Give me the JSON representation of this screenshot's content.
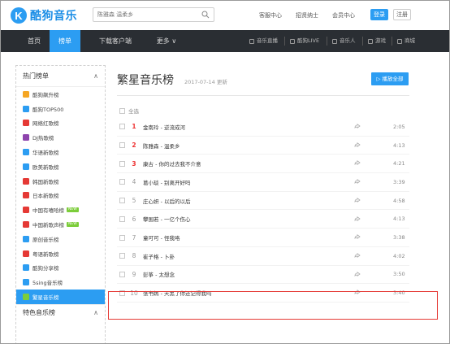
{
  "header": {
    "logo_glyph": "K",
    "logo_text": "酷狗音乐",
    "search_placeholder": "陈雅森 温柔乡",
    "links": [
      "客服中心",
      "招贤纳士",
      "会员中心"
    ],
    "login_label": "登录",
    "register_label": "注册"
  },
  "nav": {
    "items": [
      "首页",
      "榜单",
      "下载客户端",
      "更多 ∨"
    ],
    "active": "榜单",
    "right_items": [
      "音乐直播",
      "酷狗LIVE",
      "音乐人",
      "游戏",
      "商城"
    ]
  },
  "sidebar": {
    "heading": "热门榜单",
    "collapse_glyph": "∧",
    "items": [
      {
        "label": "酷狗飙升榜",
        "color": "#f5a623"
      },
      {
        "label": "酷狗TOP500",
        "color": "#2c9df2"
      },
      {
        "label": "网络红歌榜",
        "color": "#e53935"
      },
      {
        "label": "DJ热歌榜",
        "color": "#8e44ad"
      },
      {
        "label": "华语新歌榜",
        "color": "#2c9df2"
      },
      {
        "label": "欧美新歌榜",
        "color": "#2c9df2"
      },
      {
        "label": "韩国新歌榜",
        "color": "#e53935"
      },
      {
        "label": "日本新歌榜",
        "color": "#e53935"
      },
      {
        "label": "中国有嘻哈榜",
        "color": "#e53935",
        "badge": "NEW"
      },
      {
        "label": "中国新歌声榜",
        "color": "#e53935",
        "badge": "NEW"
      },
      {
        "label": "原创音乐榜",
        "color": "#2c9df2"
      },
      {
        "label": "粤语新歌榜",
        "color": "#e53935"
      },
      {
        "label": "酷狗分享榜",
        "color": "#2c9df2"
      },
      {
        "label": "5sing音乐榜",
        "color": "#2c9df2"
      },
      {
        "label": "繁星音乐榜",
        "color": "#7ccd3a",
        "active": true
      }
    ],
    "heading2": "特色音乐榜"
  },
  "main": {
    "title": "繁星音乐榜",
    "date": "2017-07-14 更新",
    "play_all": "▷ 播放全部",
    "select_all": "全选",
    "rows": [
      {
        "rank": "1",
        "top": true,
        "song": "金南玲 - 逆流成河",
        "duration": "2:05"
      },
      {
        "rank": "2",
        "top": true,
        "song": "陈雅森 - 温柔乡",
        "duration": "4:13"
      },
      {
        "rank": "3",
        "top": true,
        "song": "康古 - 你的过去我不介意",
        "duration": "4:21"
      },
      {
        "rank": "4",
        "top": false,
        "song": "葛小琰 - 别离开好吗",
        "duration": "3:39"
      },
      {
        "rank": "5",
        "top": false,
        "song": "庄心妍 - 以后的以后",
        "duration": "4:58"
      },
      {
        "rank": "6",
        "top": false,
        "song": "攀围若 - 一亿个伤心",
        "duration": "4:13"
      },
      {
        "rank": "7",
        "top": false,
        "song": "童可可 - 怪我咯",
        "duration": "3:38"
      },
      {
        "rank": "8",
        "top": false,
        "song": "崔子格 - 卜卦",
        "duration": "4:02"
      },
      {
        "rank": "9",
        "top": false,
        "song": "彭筝 - 太想念",
        "duration": "3:50"
      },
      {
        "rank": "10",
        "top": false,
        "song": "张书嫣 - 天黑了你还记得我吗",
        "duration": "3:40"
      }
    ]
  }
}
